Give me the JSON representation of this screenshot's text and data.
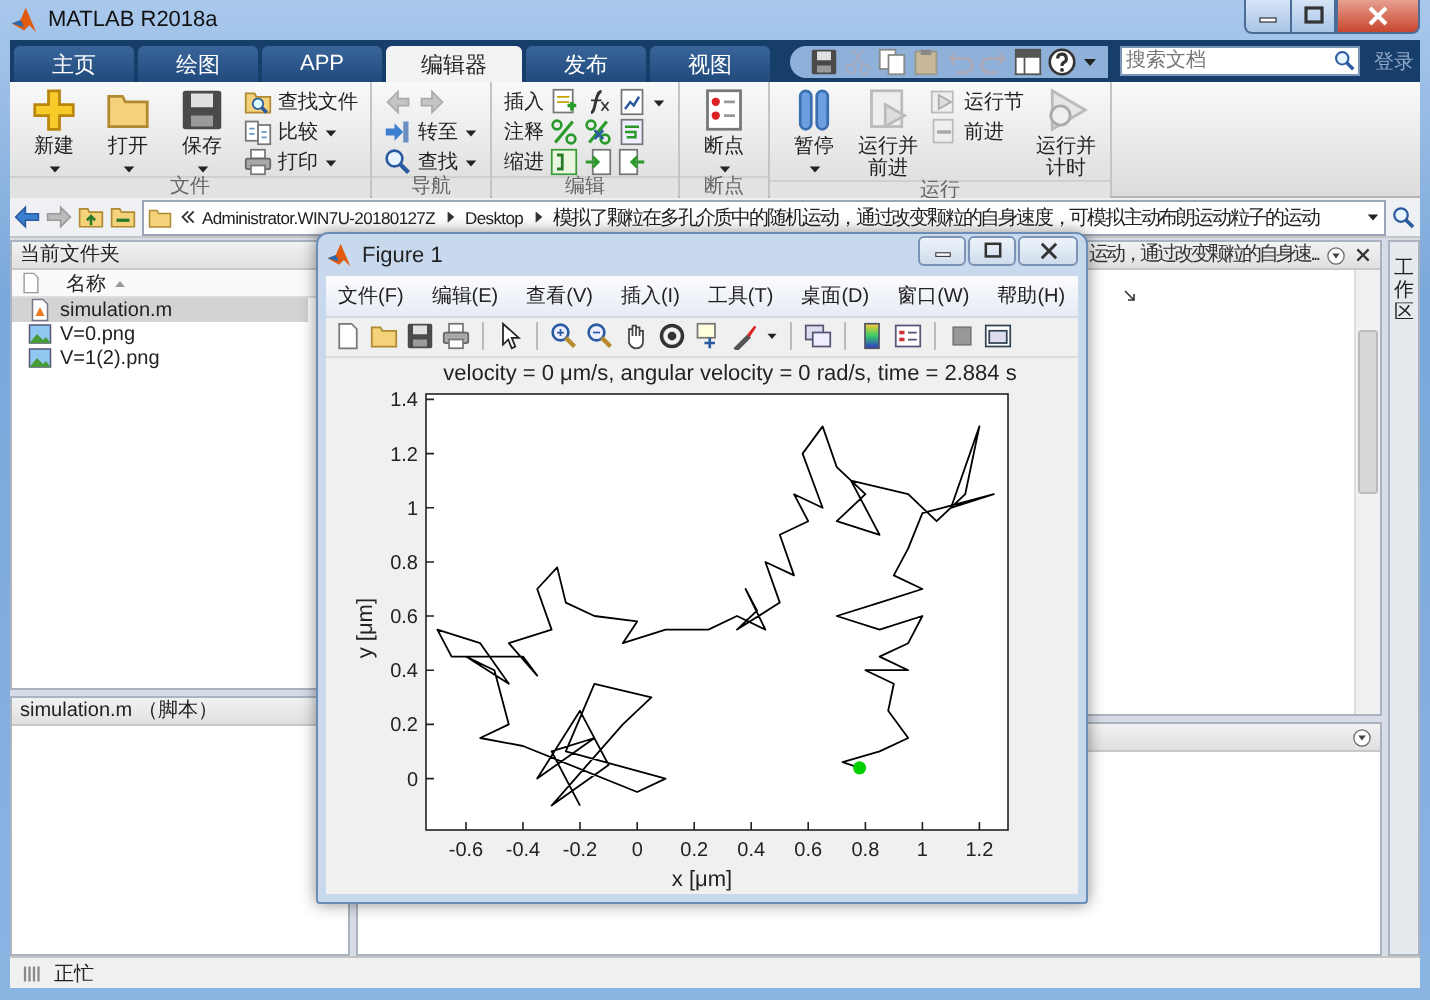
{
  "window": {
    "title": "MATLAB R2018a"
  },
  "tabs": [
    {
      "label": "主页",
      "selected": false
    },
    {
      "label": "绘图",
      "selected": false
    },
    {
      "label": "APP",
      "selected": false
    },
    {
      "label": "编辑器",
      "selected": true
    },
    {
      "label": "发布",
      "selected": false
    },
    {
      "label": "视图",
      "selected": false
    }
  ],
  "search": {
    "placeholder": "搜索文档"
  },
  "login": "登录",
  "ribbon": [
    {
      "title": "文件",
      "buttons": [
        {
          "kind": "large",
          "label": "新建",
          "dropdown": true
        },
        {
          "kind": "large",
          "label": "打开",
          "dropdown": true
        },
        {
          "kind": "large",
          "label": "保存",
          "dropdown": true
        },
        {
          "kind": "stack",
          "items": [
            {
              "kind": "button",
              "label": "查找文件",
              "dropdown": false
            },
            {
              "kind": "button",
              "label": "比较",
              "dropdown": true
            },
            {
              "kind": "button",
              "label": "打印",
              "dropdown": true
            }
          ]
        }
      ]
    },
    {
      "title": "导航",
      "buttons": [
        {
          "kind": "stack",
          "items": [
            {
              "kind": "arrows"
            },
            {
              "kind": "button",
              "label": "转至",
              "dropdown": true
            },
            {
              "kind": "button",
              "label": "查找",
              "dropdown": true
            }
          ]
        }
      ]
    },
    {
      "title": "编辑",
      "buttons": [
        {
          "kind": "stack",
          "items": [
            {
              "kind": "tools",
              "label": "插入",
              "dropdown": true
            },
            {
              "kind": "tools",
              "label": "注释",
              "dropdown": false
            },
            {
              "kind": "tools",
              "label": "缩进",
              "dropdown": false
            }
          ]
        }
      ]
    },
    {
      "title": "断点",
      "buttons": [
        {
          "kind": "large",
          "label": "断点",
          "dropdown": true
        }
      ]
    },
    {
      "title": "运行",
      "buttons": [
        {
          "kind": "large",
          "label": "暂停",
          "dropdown": true
        },
        {
          "kind": "large",
          "label": "运行并前进",
          "dropdown": false
        },
        {
          "kind": "stack",
          "items": [
            {
              "kind": "button",
              "label": "运行节",
              "dropdown": false
            },
            {
              "kind": "button",
              "label": "前进",
              "dropdown": false
            }
          ]
        },
        {
          "kind": "large",
          "label": "运行并计时",
          "dropdown": false
        }
      ]
    }
  ],
  "address_bar": {
    "segments": [
      "Administrator.WIN7U-20180127Z",
      "Desktop",
      "模拟了颗粒在多孔介质中的随机运动，通过改变颗粒的自身速度，可模拟主动布朗运动粒子的运动"
    ]
  },
  "current_folder": {
    "title": "当前文件夹",
    "column": "名称",
    "files": [
      {
        "name": "simulation.m",
        "kind": "script",
        "selected": true
      },
      {
        "name": "V=0.png",
        "kind": "image",
        "selected": false
      },
      {
        "name": "V=1(2).png",
        "kind": "image",
        "selected": false
      }
    ],
    "details": "simulation.m （脚本）"
  },
  "editor": {
    "title": "运动，通过改变颗粒的自身速..."
  },
  "workspace_tab": "工作区",
  "figure": {
    "title": "Figure 1",
    "menu": [
      "文件(F)",
      "编辑(E)",
      "查看(V)",
      "插入(I)",
      "工具(T)",
      "桌面(D)",
      "窗口(W)",
      "帮助(H)"
    ],
    "chart_data": {
      "type": "line",
      "title": "velocity = 0 μm/s, angular velocity = 0 rad/s, time = 2.884 s",
      "xlabel": "x [μm]",
      "ylabel": "y [μm]",
      "x": [
        -0.2,
        -0.3,
        -0.15,
        -0.35,
        -0.2,
        -0.1,
        -0.3,
        -0.05,
        0.05,
        -0.15,
        -0.25,
        0.1,
        0.0,
        -0.4,
        -0.55,
        -0.45,
        -0.5,
        -0.6,
        -0.45,
        -0.55,
        -0.7,
        -0.65,
        -0.4,
        -0.35,
        -0.45,
        -0.3,
        -0.35,
        -0.28,
        -0.25,
        -0.15,
        0.0,
        -0.05,
        0.1,
        0.25,
        0.35,
        0.45,
        0.38,
        0.42,
        0.35,
        0.5,
        0.45,
        0.55,
        0.5,
        0.6,
        0.55,
        0.65,
        0.58,
        0.65,
        0.7,
        0.8,
        0.7,
        0.85,
        0.75,
        0.95,
        1.05,
        1.15,
        1.2,
        1.1,
        1.25,
        1.0,
        0.95,
        0.9,
        1.0,
        0.85,
        0.7,
        0.85,
        1.0,
        0.95,
        0.85,
        0.95,
        0.8,
        0.9,
        0.88,
        0.95,
        0.85,
        0.72,
        0.78
      ],
      "series": [
        {
          "color": "#000000",
          "values": [
            -0.1,
            0.1,
            0.15,
            0.0,
            0.25,
            0.05,
            -0.1,
            0.2,
            0.3,
            0.35,
            0.1,
            0.0,
            -0.05,
            0.12,
            0.15,
            0.2,
            0.4,
            0.45,
            0.35,
            0.5,
            0.55,
            0.45,
            0.45,
            0.38,
            0.5,
            0.55,
            0.7,
            0.78,
            0.65,
            0.6,
            0.58,
            0.5,
            0.55,
            0.55,
            0.6,
            0.55,
            0.7,
            0.62,
            0.55,
            0.65,
            0.8,
            0.75,
            0.9,
            0.95,
            1.05,
            1.0,
            1.2,
            1.3,
            1.15,
            1.05,
            0.95,
            0.9,
            1.1,
            1.05,
            0.95,
            1.05,
            1.3,
            1.0,
            1.05,
            0.98,
            0.85,
            0.75,
            0.7,
            0.65,
            0.6,
            0.55,
            0.6,
            0.5,
            0.45,
            0.4,
            0.4,
            0.35,
            0.25,
            0.15,
            0.1,
            0.06,
            0.04
          ]
        },
        {
          "color": "#00d000",
          "marker": "circle",
          "values": [
            null,
            null,
            null,
            null,
            null,
            null,
            null,
            null,
            null,
            null,
            null,
            null,
            null,
            null,
            null,
            null,
            null,
            null,
            null,
            null,
            null,
            null,
            null,
            null,
            null,
            null,
            null,
            null,
            null,
            null,
            null,
            null,
            null,
            null,
            null,
            null,
            null,
            null,
            null,
            null,
            null,
            null,
            null,
            null,
            null,
            null,
            null,
            null,
            null,
            null,
            null,
            null,
            null,
            null,
            null,
            null,
            null,
            null,
            null,
            null,
            null,
            null,
            null,
            null,
            null,
            null,
            null,
            null,
            null,
            null,
            null,
            null,
            null,
            null,
            null,
            null,
            0.04
          ]
        }
      ],
      "xlim": [
        -0.74,
        1.3
      ],
      "ylim": [
        -0.19,
        1.42
      ],
      "xticks": [
        -0.6,
        -0.4,
        -0.2,
        0,
        0.2,
        0.4,
        0.6,
        0.8,
        1,
        1.2
      ],
      "yticks": [
        0,
        0.2,
        0.4,
        0.6,
        0.8,
        1,
        1.2,
        1.4
      ]
    }
  },
  "status_bar": {
    "text": "正忙"
  }
}
